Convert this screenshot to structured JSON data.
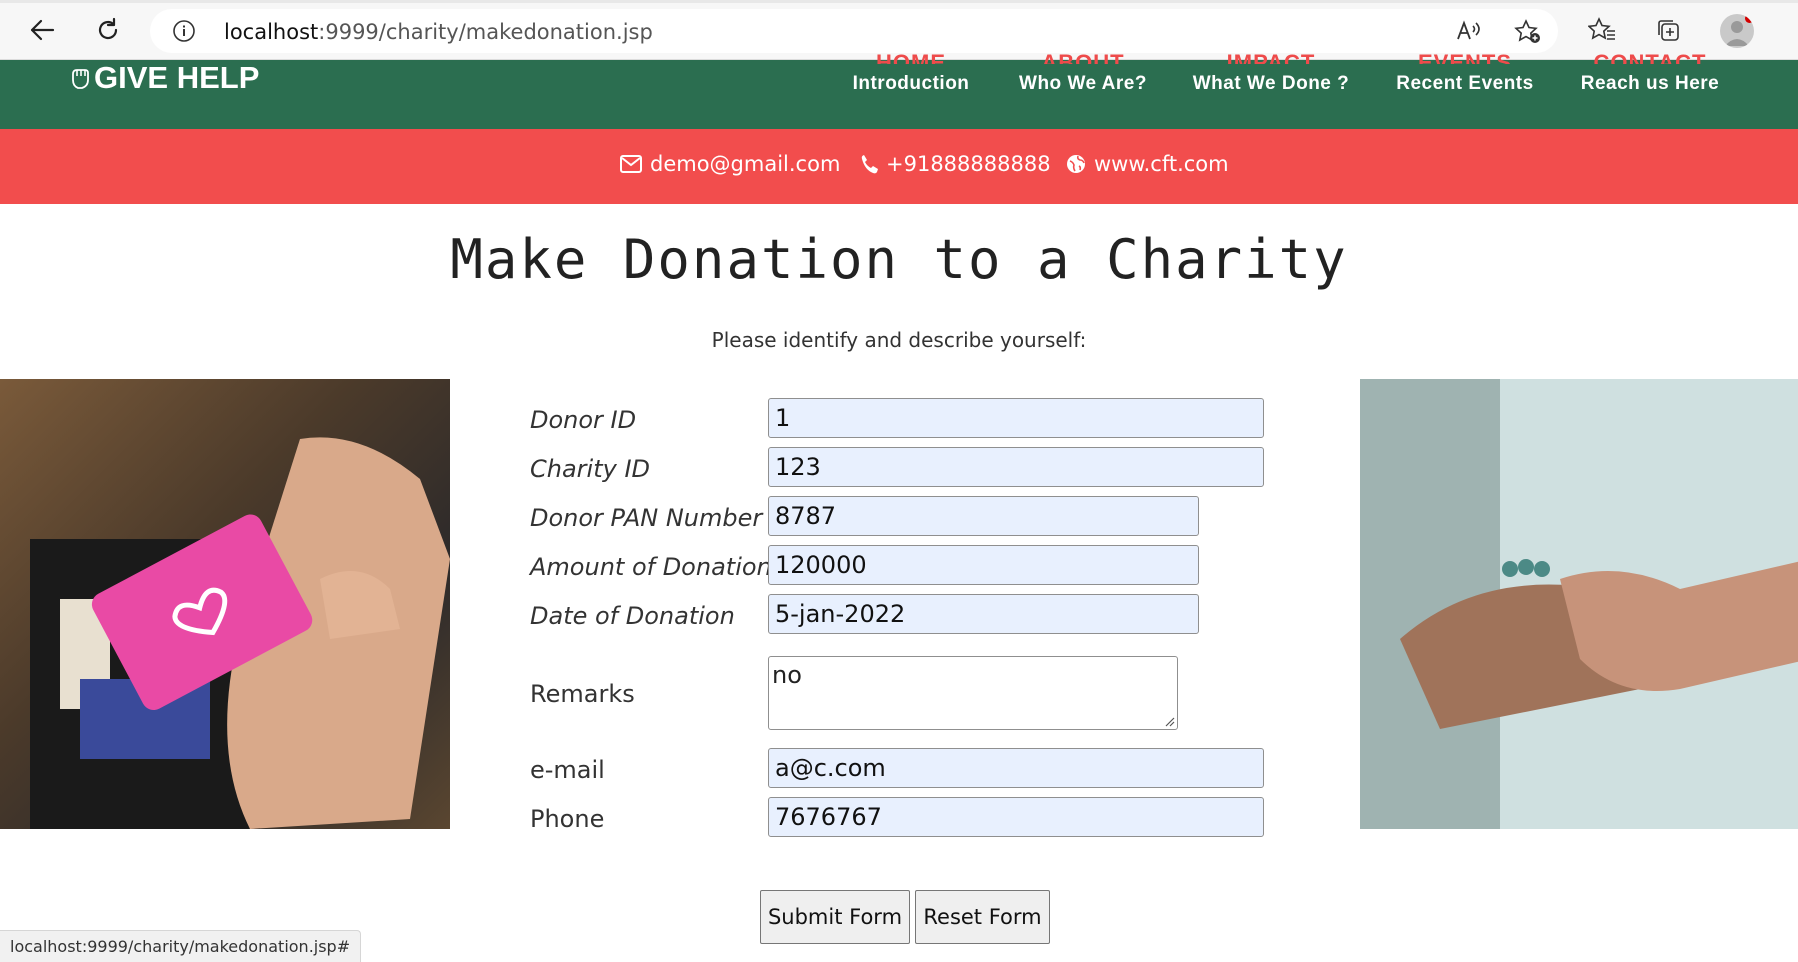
{
  "browser": {
    "url_host": "localhost",
    "url_rest": ":9999/charity/makedonation.jsp",
    "status_url": "localhost:9999/charity/makedonation.jsp#"
  },
  "site": {
    "logo_text": "GIVE HELP",
    "menu": [
      {
        "ghost": "HOME",
        "label": "Introduction"
      },
      {
        "ghost": "ABOUT",
        "label": "Who We Are?"
      },
      {
        "ghost": "IMPACT",
        "label": "What We Done ?"
      },
      {
        "ghost": "EVENTS",
        "label": "Recent Events"
      },
      {
        "ghost": "CONTACT",
        "label": "Reach us Here"
      }
    ],
    "contact": {
      "email": "demo@gmail.com",
      "phone": "+91888888888",
      "website": "www.cft.com"
    }
  },
  "page": {
    "title": "Make Donation to a Charity",
    "subtitle": "Please identify and describe yourself:"
  },
  "form": {
    "donor_id": {
      "label": "Donor ID",
      "value": "1"
    },
    "charity_id": {
      "label": "Charity ID",
      "value": "123"
    },
    "pan": {
      "label": "Donor PAN Number",
      "value": "8787"
    },
    "amount": {
      "label": "Amount of Donation",
      "value": "120000"
    },
    "date": {
      "label": "Date of Donation",
      "value": "5-jan-2022"
    },
    "remarks": {
      "label": "Remarks",
      "value": "no"
    },
    "email": {
      "label": "e-mail",
      "value": "a@c.com"
    },
    "phone": {
      "label": "Phone",
      "value": "7676767"
    },
    "submit_label": "Submit Form",
    "reset_label": "Reset Form"
  },
  "colors": {
    "nav_green": "#2b6e50",
    "contact_red": "#f24d4d",
    "autofill_bg": "#e8f0fe"
  }
}
